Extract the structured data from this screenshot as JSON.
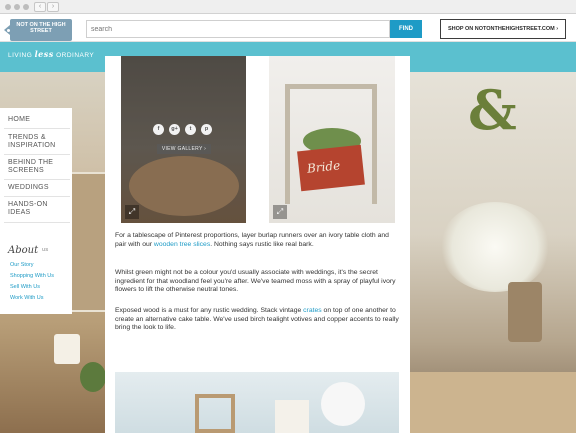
{
  "browser": {
    "back_label": "‹",
    "forward_label": "›"
  },
  "header": {
    "logo_text": "NOT ON THE HIGH STREET",
    "search_placeholder": "search",
    "find_label": "FIND",
    "shop_label": "SHOP ON NOTONTHEHIGHSTREET.COM ›"
  },
  "tagline": {
    "before": "LIVING ",
    "emphasis": "less",
    "after": " ORDINARY"
  },
  "sidebar": {
    "items": [
      {
        "label": "HOME"
      },
      {
        "label": "TRENDS & INSPIRATION"
      },
      {
        "label": "BEHIND THE SCREENS"
      },
      {
        "label": "WEDDINGS"
      },
      {
        "label": "HANDS-ON IDEAS"
      }
    ],
    "about_title": "About",
    "about_sub": "US",
    "about_links": [
      "Our Story",
      "Shopping With Us",
      "Sell With Us",
      "Work With Us"
    ]
  },
  "gallery": {
    "social_icons": [
      "facebook-icon",
      "google-plus-icon",
      "twitter-icon",
      "pinterest-icon"
    ],
    "social_glyphs": [
      "f",
      "g+",
      "t",
      "p"
    ],
    "view_gallery_label": "VIEW GALLERY ›",
    "sign_text": "Bride"
  },
  "article": {
    "p1_before": "For a tablescape of Pinterest proportions, layer burlap runners over an ivory table cloth and pair with our ",
    "p1_link": "wooden tree slices",
    "p1_after": ". Nothing says rustic like real bark.",
    "p2": "Whilst green might not be a colour you'd usually associate with weddings, it's the secret ingredient for that woodland feel you're after. We've teamed moss with a spray of playful ivory flowers to lift the otherwise neutral tones.",
    "p3_before": "Exposed wood is a must for any rustic wedding. Stack vintage ",
    "p3_link": "crates",
    "p3_after": " on top of one another to create an alternative cake table. We've used birch tealight votives and copper accents to really bring the look to life."
  },
  "colors": {
    "teal": "#5bc0cf",
    "link": "#1e9bc6",
    "find_button": "#1e9bc6"
  }
}
